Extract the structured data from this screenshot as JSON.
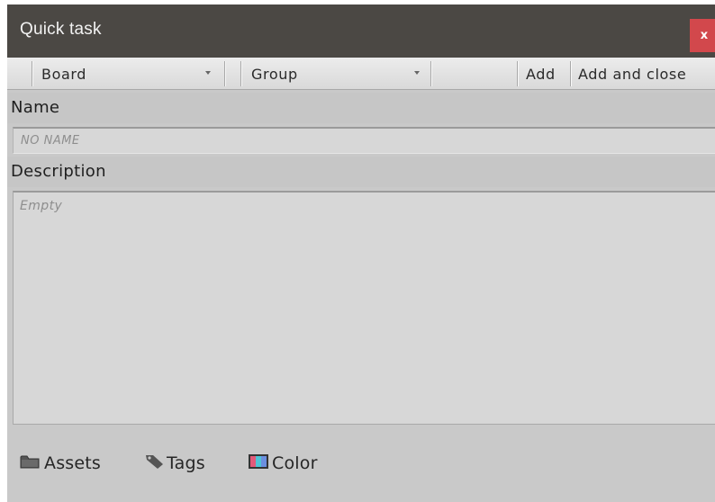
{
  "window": {
    "title": "Quick task",
    "close_label": "x"
  },
  "toolbar": {
    "board_label": "Board",
    "group_label": "Group",
    "add_label": "Add",
    "add_close_label": "Add and close"
  },
  "name": {
    "label": "Name",
    "placeholder": "NO NAME",
    "value": ""
  },
  "description": {
    "label": "Description",
    "placeholder": "Empty",
    "value": ""
  },
  "footer": {
    "assets_label": "Assets",
    "tags_label": "Tags",
    "color_label": "Color"
  },
  "icons": {
    "folder": "folder-icon",
    "tag": "tag-icon",
    "color": "color-palette-icon"
  },
  "colors": {
    "titlebar": "#4b4844",
    "close": "#d2484c",
    "panel": "#c9c9c9"
  }
}
